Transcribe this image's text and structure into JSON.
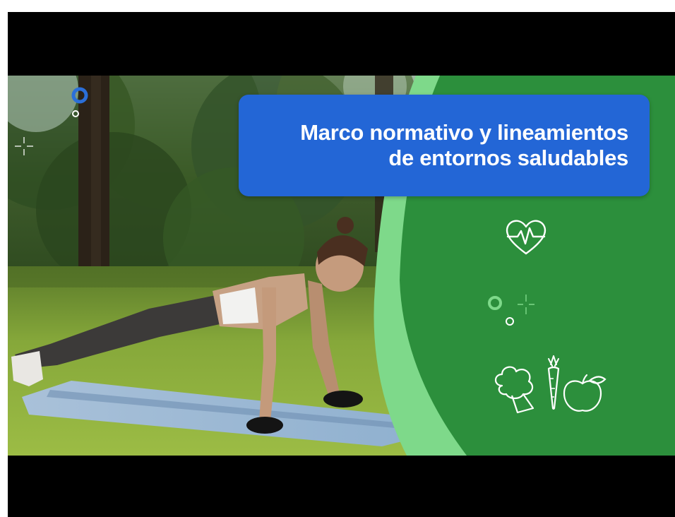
{
  "video": {
    "title_lines": [
      "Marco normativo y lineamientos",
      "de entornos saludables"
    ],
    "colors": {
      "background": "#ffffff",
      "letterbox": "#000000",
      "title_card": "#2366d6",
      "green_panel": "#2c8f3c",
      "light_green_arc": "#7ed98a",
      "accent_blue": "#2b6fd8"
    },
    "icons": [
      "heart-pulse-icon",
      "broccoli-icon",
      "carrot-icon",
      "apple-icon",
      "sparkle-icon",
      "circle-icon"
    ]
  }
}
